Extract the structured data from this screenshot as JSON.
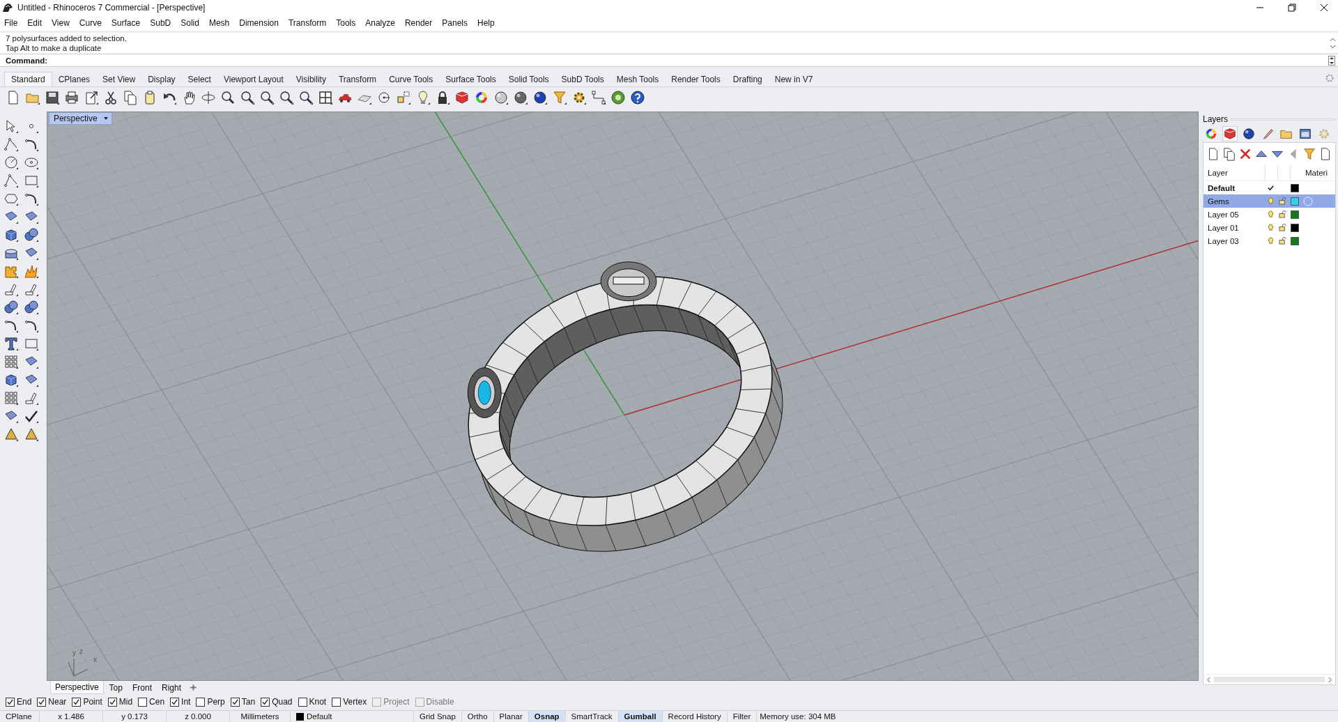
{
  "window": {
    "title": "Untitled - Rhinoceros 7 Commercial - [Perspective]"
  },
  "menu": [
    "File",
    "Edit",
    "View",
    "Curve",
    "Surface",
    "SubD",
    "Solid",
    "Mesh",
    "Dimension",
    "Transform",
    "Tools",
    "Analyze",
    "Render",
    "Panels",
    "Help"
  ],
  "command_history": [
    "7 polysurfaces added to selection.",
    "Tap Alt to make a duplicate"
  ],
  "command_prompt": "Command:",
  "toolbar_tabs": [
    {
      "label": "Standard",
      "selected": true
    },
    {
      "label": "CPlanes",
      "selected": false
    },
    {
      "label": "Set View",
      "selected": false
    },
    {
      "label": "Display",
      "selected": false
    },
    {
      "label": "Select",
      "selected": false
    },
    {
      "label": "Viewport Layout",
      "selected": false
    },
    {
      "label": "Visibility",
      "selected": false
    },
    {
      "label": "Transform",
      "selected": false
    },
    {
      "label": "Curve Tools",
      "selected": false
    },
    {
      "label": "Surface Tools",
      "selected": false
    },
    {
      "label": "Solid Tools",
      "selected": false
    },
    {
      "label": "SubD Tools",
      "selected": false
    },
    {
      "label": "Mesh Tools",
      "selected": false
    },
    {
      "label": "Render Tools",
      "selected": false
    },
    {
      "label": "Drafting",
      "selected": false
    },
    {
      "label": "New in V7",
      "selected": false
    }
  ],
  "viewport": {
    "title": "Perspective",
    "axis_labels": [
      "y",
      "z",
      "x"
    ]
  },
  "viewport_tabs": [
    {
      "label": "Perspective",
      "selected": true
    },
    {
      "label": "Top",
      "selected": false
    },
    {
      "label": "Front",
      "selected": false
    },
    {
      "label": "Right",
      "selected": false
    }
  ],
  "layers_panel": {
    "title": "Layers",
    "columns": [
      "Layer",
      "Materi"
    ],
    "layers": [
      {
        "name": "Default",
        "current": true,
        "selected": false,
        "color": "#000000"
      },
      {
        "name": "Gems",
        "current": false,
        "selected": true,
        "color": "#2fd2ee"
      },
      {
        "name": "Layer 05",
        "current": false,
        "selected": false,
        "color": "#117a1c"
      },
      {
        "name": "Layer 01",
        "current": false,
        "selected": false,
        "color": "#000000"
      },
      {
        "name": "Layer 03",
        "current": false,
        "selected": false,
        "color": "#117a1c"
      }
    ]
  },
  "osnaps": [
    {
      "label": "End",
      "checked": true,
      "disabled": false
    },
    {
      "label": "Near",
      "checked": true,
      "disabled": false
    },
    {
      "label": "Point",
      "checked": true,
      "disabled": false
    },
    {
      "label": "Mid",
      "checked": true,
      "disabled": false
    },
    {
      "label": "Cen",
      "checked": false,
      "disabled": false
    },
    {
      "label": "Int",
      "checked": true,
      "disabled": false
    },
    {
      "label": "Perp",
      "checked": false,
      "disabled": false
    },
    {
      "label": "Tan",
      "checked": true,
      "disabled": false
    },
    {
      "label": "Quad",
      "checked": true,
      "disabled": false
    },
    {
      "label": "Knot",
      "checked": false,
      "disabled": false
    },
    {
      "label": "Vertex",
      "checked": false,
      "disabled": false
    },
    {
      "label": "Project",
      "checked": false,
      "disabled": true
    },
    {
      "label": "Disable",
      "checked": false,
      "disabled": true
    }
  ],
  "status_bar": {
    "cplane": "CPlane",
    "x": "x 1.486",
    "y": "y 0.173",
    "z": "z 0.000",
    "units": "Millimeters",
    "layer": "Default",
    "toggles": [
      {
        "label": "Grid Snap",
        "on": false
      },
      {
        "label": "Ortho",
        "on": false
      },
      {
        "label": "Planar",
        "on": false
      },
      {
        "label": "Osnap",
        "on": true
      },
      {
        "label": "SmartTrack",
        "on": false
      },
      {
        "label": "Gumball",
        "on": true
      },
      {
        "label": "Record History",
        "on": false
      },
      {
        "label": "Filter",
        "on": false
      }
    ],
    "memory": "Memory use: 304 MB"
  }
}
